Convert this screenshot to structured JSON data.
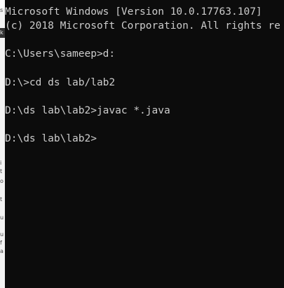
{
  "terminal": {
    "lines": [
      "Microsoft Windows [Version 10.0.17763.107]",
      "(c) 2018 Microsoft Corporation. All rights re",
      "",
      "C:\\Users\\sameep>d:",
      "",
      "D:\\>cd ds lab/lab2",
      "",
      "D:\\ds lab\\lab2>javac *.java",
      "",
      "D:\\ds lab\\lab2>"
    ]
  },
  "behind_window": {
    "fragments": [
      "s",
      "k",
      "i",
      "t",
      "o",
      "t",
      "u",
      "u",
      "f",
      "a"
    ]
  },
  "colors": {
    "console_background": "#0c0c0c",
    "console_text": "#cccccc"
  }
}
